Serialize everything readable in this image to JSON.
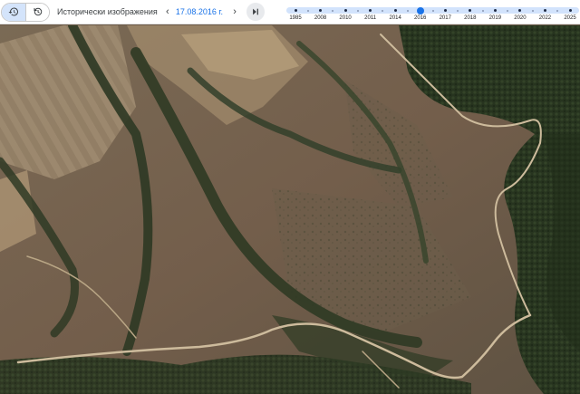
{
  "toolbar": {
    "mode_buttons": [
      {
        "name": "history-mode",
        "icon": "history-icon",
        "active": true
      },
      {
        "name": "restore-mode",
        "icon": "refresh-icon",
        "active": false
      }
    ],
    "historical_label": "Исторически изображения",
    "prev_icon": "chevron-left-icon",
    "next_icon": "chevron-right-icon",
    "date": "17.08.2016 г.",
    "latest_icon": "skip-to-latest-icon",
    "prev_glyph": "‹",
    "next_glyph": "›"
  },
  "timeline": {
    "years": [
      "1985",
      "2008",
      "2010",
      "2011",
      "2014",
      "2016",
      "2017",
      "2018",
      "2019",
      "2020",
      "2022",
      "2025"
    ],
    "selected_year": "2016",
    "track_color": "#d2e3fc",
    "selected_color": "#1a73e8"
  },
  "colors": {
    "accent": "#1a73e8",
    "toolbar_bg": "#ffffff",
    "active_mode_bg": "#d4e4fb"
  },
  "map": {
    "type": "satellite-imagery"
  }
}
